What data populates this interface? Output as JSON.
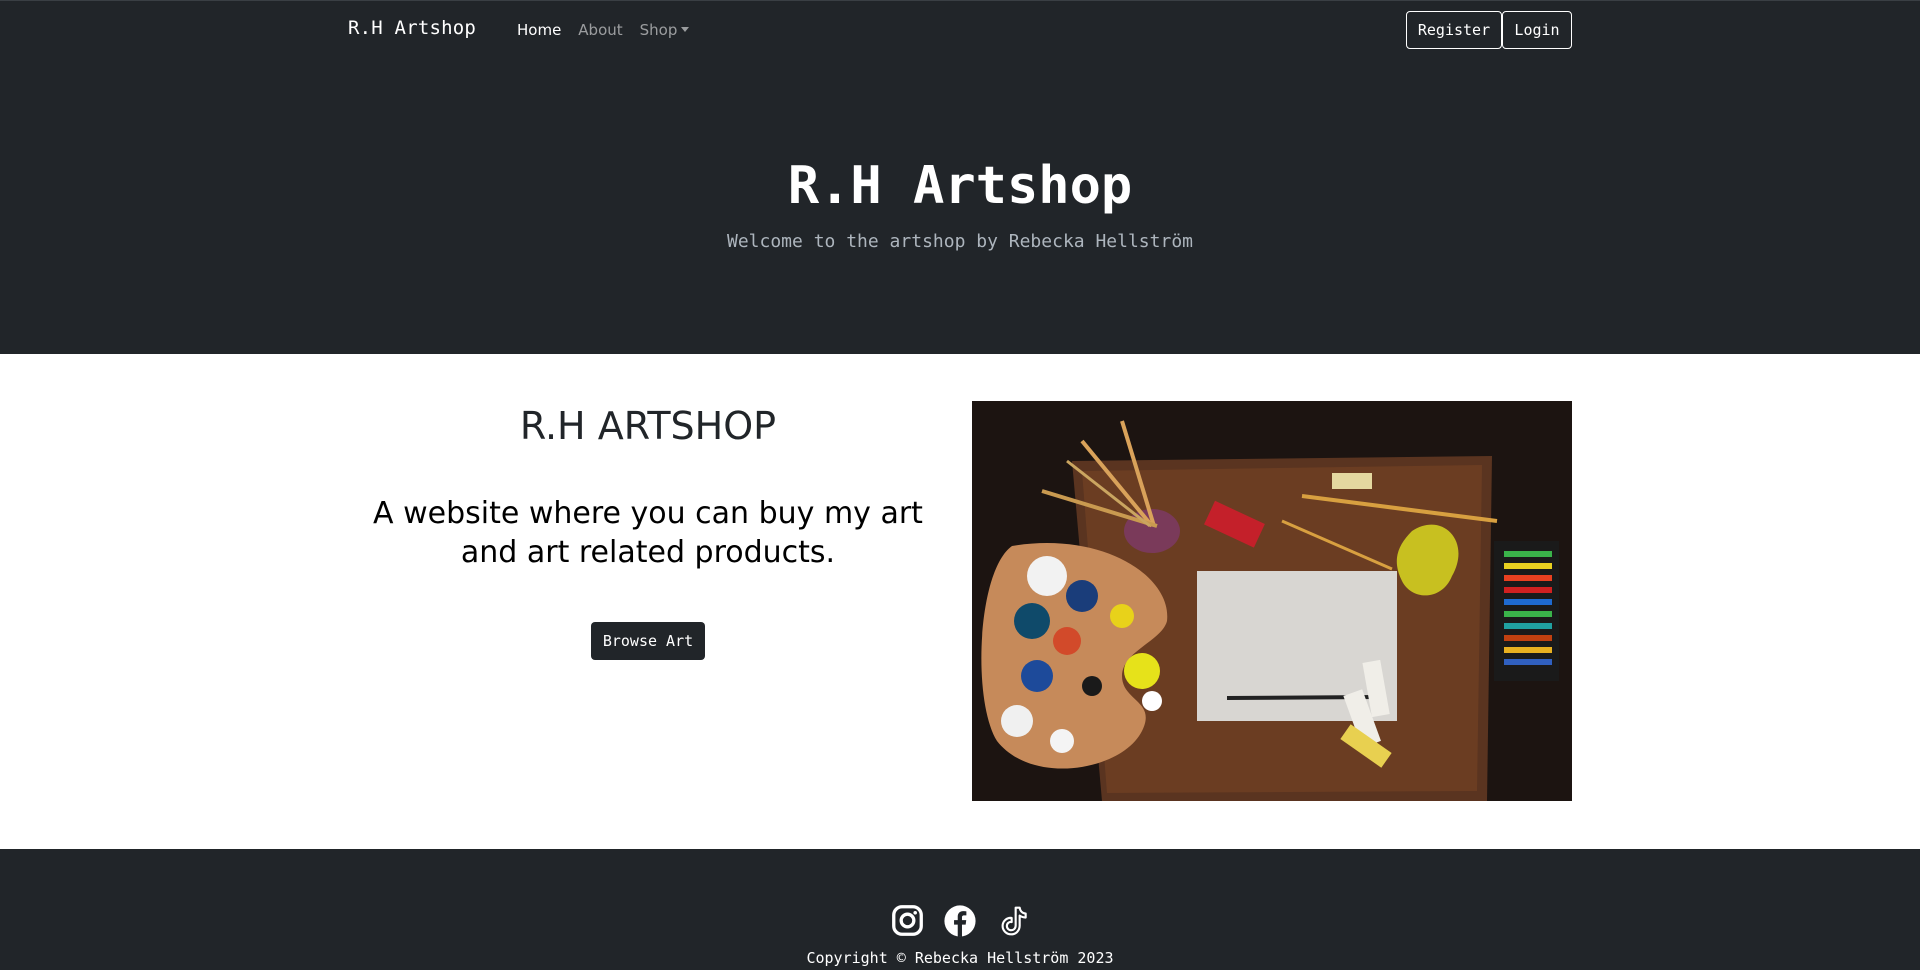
{
  "navbar": {
    "brand": "R.H Artshop",
    "links": [
      {
        "label": "Home",
        "active": true
      },
      {
        "label": "About",
        "active": false
      },
      {
        "label": "Shop",
        "active": false,
        "dropdown": true
      }
    ],
    "register_label": "Register",
    "login_label": "Login"
  },
  "hero": {
    "title": "R.H Artshop",
    "subtitle": "Welcome to the artshop by Rebecka Hellström"
  },
  "main": {
    "heading": "R.H ARTSHOP",
    "text": "A website where you can buy my art and art related products.",
    "button_label": "Browse Art",
    "image_description_icon": "artist-desk-photo"
  },
  "footer": {
    "social_icons": [
      "instagram-icon",
      "facebook-icon",
      "tiktok-icon"
    ],
    "copyright": "Copyright © Rebecka Hellström 2023"
  },
  "colors": {
    "dark": "#212529",
    "muted_text": "#adb5bd",
    "white": "#ffffff"
  }
}
